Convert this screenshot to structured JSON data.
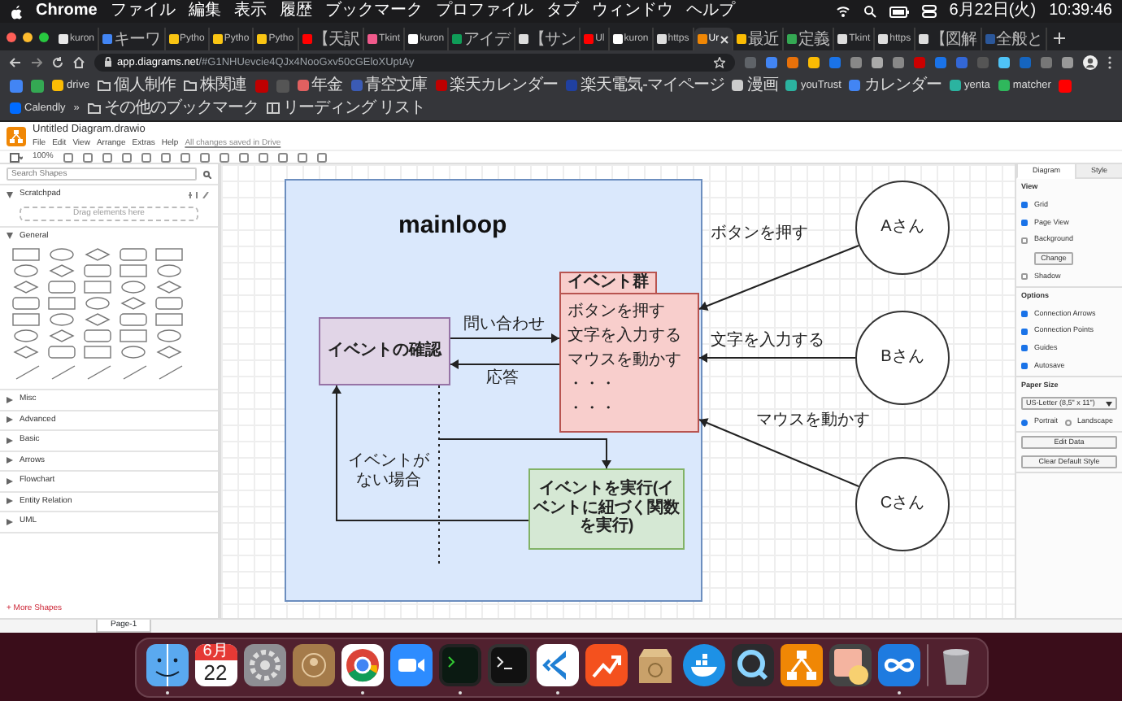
{
  "menubar": {
    "app": "Chrome",
    "menus": [
      "ファイル",
      "編集",
      "表示",
      "履歴",
      "ブックマーク",
      "プロファイル",
      "タブ",
      "ウィンドウ",
      "ヘルプ"
    ],
    "date": "6月22日(火)",
    "time": "10:39:46"
  },
  "tabs": [
    {
      "title": "kuron",
      "color": "#e8e8e8",
      "selected": false
    },
    {
      "title": "キーワ",
      "color": "#4285f4",
      "selected": false
    },
    {
      "title": "Pytho",
      "color": "#f9c513",
      "selected": false
    },
    {
      "title": "Pytho",
      "color": "#f9c513",
      "selected": false
    },
    {
      "title": "Pytho",
      "color": "#f9c513",
      "selected": false
    },
    {
      "title": "【天訳",
      "color": "#ff0000",
      "selected": false
    },
    {
      "title": "Tkint",
      "color": "#f05a8c",
      "selected": false
    },
    {
      "title": "kuron",
      "color": "#ffffff",
      "selected": false
    },
    {
      "title": "アイデ",
      "color": "#0f9d58",
      "selected": false
    },
    {
      "title": "【サン",
      "color": "#dddddd",
      "selected": false
    },
    {
      "title": "Ul",
      "color": "#ff0000",
      "selected": false
    },
    {
      "title": "kuron",
      "color": "#ffffff",
      "selected": false
    },
    {
      "title": "https",
      "color": "#dddddd",
      "selected": false
    },
    {
      "title": "Ur",
      "color": "#f08705",
      "selected": true
    },
    {
      "title": "最近",
      "color": "#fbbc04",
      "selected": false
    },
    {
      "title": "定義",
      "color": "#34a853",
      "selected": false
    },
    {
      "title": "Tkint",
      "color": "#dddddd",
      "selected": false
    },
    {
      "title": "https",
      "color": "#dddddd",
      "selected": false
    },
    {
      "title": "【図解",
      "color": "#dddddd",
      "selected": false
    },
    {
      "title": "全般と",
      "color": "#2b579a",
      "selected": false
    }
  ],
  "address": {
    "host": "app.diagrams.net",
    "path": "/#G1NHUevcie4QJx4NooGxv50cGEloXUptAy"
  },
  "bookmarks": [
    {
      "kind": "icon",
      "color": "#4285f4"
    },
    {
      "kind": "icon",
      "color": "#34a853"
    },
    {
      "kind": "link",
      "label": "drive",
      "color": "#fbbc04"
    },
    {
      "kind": "folder",
      "label": "個人制作"
    },
    {
      "kind": "folder",
      "label": "株関連"
    },
    {
      "kind": "icon",
      "color": "#bf0000"
    },
    {
      "kind": "icon",
      "color": "#555555"
    },
    {
      "kind": "link",
      "label": "年金",
      "color": "#e06060"
    },
    {
      "kind": "link",
      "label": "青空文庫",
      "color": "#3b5bb5"
    },
    {
      "kind": "link",
      "label": "楽天カレンダー",
      "color": "#bf0000"
    },
    {
      "kind": "link",
      "label": "楽天電気-マイページ",
      "color": "#2040a0"
    },
    {
      "kind": "link",
      "label": "漫画",
      "color": "#cccccc"
    },
    {
      "kind": "link",
      "label": "youTrust",
      "color": "#2bb3a0"
    },
    {
      "kind": "link",
      "label": "カレンダー",
      "color": "#4285f4"
    },
    {
      "kind": "link",
      "label": "yenta",
      "color": "#2bb3a0"
    },
    {
      "kind": "link",
      "label": "matcher",
      "color": "#2fb85c"
    },
    {
      "kind": "icon",
      "color": "#ff0000"
    },
    {
      "kind": "link",
      "label": "Calendly",
      "color": "#006bff"
    },
    {
      "kind": "more",
      "label": "»"
    },
    {
      "kind": "folder",
      "label": "その他のブックマーク"
    },
    {
      "kind": "reading",
      "label": "リーディング リスト"
    }
  ],
  "drawio": {
    "title": "Untitled Diagram.drawio",
    "menus": [
      "File",
      "Edit",
      "View",
      "Arrange",
      "Extras",
      "Help"
    ],
    "save_status": "All changes saved in Drive",
    "zoom": "100%",
    "sidebar": {
      "search": {
        "placeholder": "Search Shapes"
      },
      "scratchpad": "Scratchpad",
      "drop_hint": "Drag elements here",
      "sections": [
        {
          "label": "General",
          "expanded": true
        },
        {
          "label": "Misc",
          "expanded": false
        },
        {
          "label": "Advanced",
          "expanded": false
        },
        {
          "label": "Basic",
          "expanded": false
        },
        {
          "label": "Arrows",
          "expanded": false
        },
        {
          "label": "Flowchart",
          "expanded": false
        },
        {
          "label": "Entity Relation",
          "expanded": false
        },
        {
          "label": "UML",
          "expanded": false
        }
      ],
      "more_shapes": "+ More Shapes"
    },
    "page_tab": "Page-1",
    "format_panel": {
      "tabs": [
        {
          "label": "Diagram",
          "selected": true
        },
        {
          "label": "Style",
          "selected": false
        }
      ],
      "view_title": "View",
      "view_options": [
        {
          "label": "Grid",
          "checked": true
        },
        {
          "label": "Page View",
          "checked": true
        },
        {
          "label": "Background",
          "checked": false
        },
        {
          "label": "Shadow",
          "checked": false
        }
      ],
      "change_button": "Change",
      "options_title": "Options",
      "options": [
        {
          "label": "Connection Arrows",
          "checked": true
        },
        {
          "label": "Connection Points",
          "checked": true
        },
        {
          "label": "Guides",
          "checked": true
        },
        {
          "label": "Autosave",
          "checked": true
        }
      ],
      "paper_title": "Paper Size",
      "paper_size": "US-Letter (8,5\" x 11\")",
      "orientation": [
        {
          "label": "Portrait",
          "selected": true
        },
        {
          "label": "Landscape",
          "selected": false
        }
      ],
      "buttons": [
        "Edit Data",
        "Clear Default Style"
      ]
    },
    "diagram": {
      "title": "mainloop",
      "check_box": "イベントの確認",
      "event_group": {
        "title": "イベント群",
        "items": [
          "ボタンを押す",
          "文字を入力する",
          "マウスを動かす",
          "・・・",
          "・・・"
        ]
      },
      "execute_box": "イベントを実行(イベントに紐づく関数を実行)",
      "inquiry_label": "問い合わせ",
      "response_label": "応答",
      "no_event_label": "イベントがない場合",
      "users": [
        {
          "label": "Aさん",
          "action": "ボタンを押す"
        },
        {
          "label": "Bさん",
          "action": "文字を入力する"
        },
        {
          "label": "Cさん",
          "action": "マウスを動かす"
        }
      ]
    }
  },
  "dock": [
    {
      "kind": "finder",
      "running": true
    },
    {
      "kind": "calendar",
      "month": "6月",
      "day": "22",
      "running": false
    },
    {
      "kind": "gear",
      "running": false
    },
    {
      "kind": "contacts",
      "running": false
    },
    {
      "kind": "wheel",
      "running": true
    },
    {
      "kind": "camera",
      "running": false
    },
    {
      "kind": "terminal-green",
      "running": true
    },
    {
      "kind": "terminal",
      "running": false
    },
    {
      "kind": "chevron",
      "running": true
    },
    {
      "kind": "trend",
      "running": false
    },
    {
      "kind": "box",
      "running": false
    },
    {
      "kind": "whale",
      "running": false
    },
    {
      "kind": "lens",
      "running": false
    },
    {
      "kind": "flowchart",
      "running": false
    },
    {
      "kind": "photos",
      "running": false
    },
    {
      "kind": "infinity",
      "running": true
    },
    {
      "kind": "separator"
    },
    {
      "kind": "trash",
      "running": false
    }
  ]
}
